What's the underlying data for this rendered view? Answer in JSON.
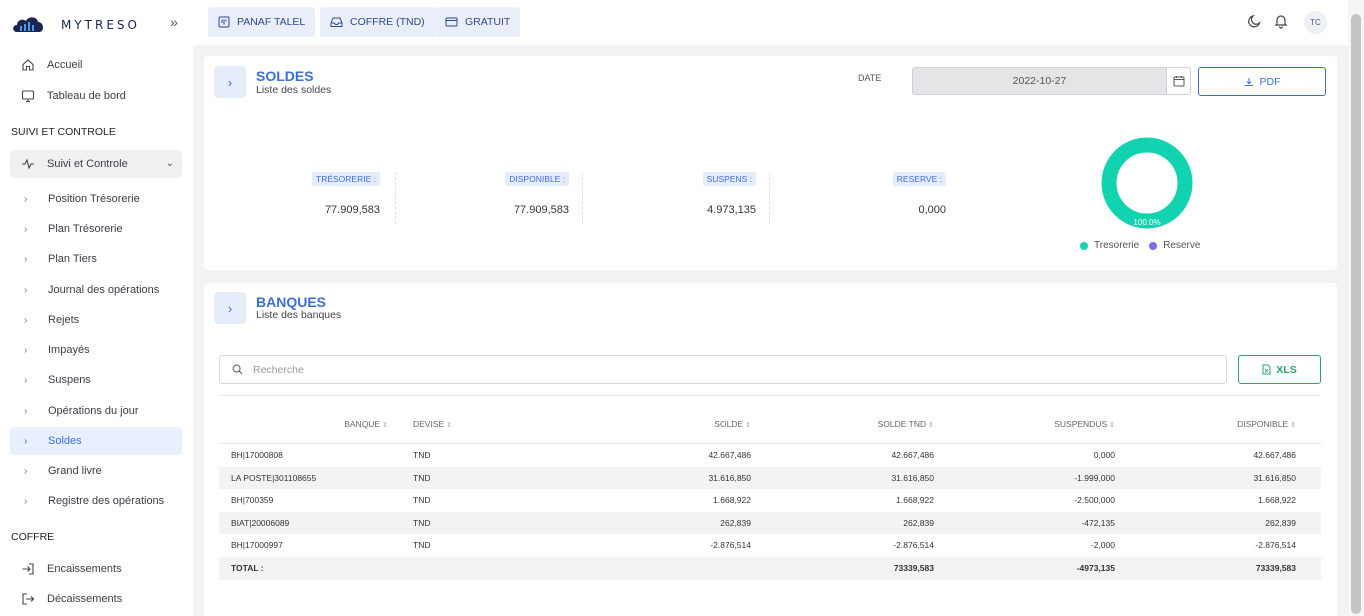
{
  "brand": {
    "name": "MYTRESO"
  },
  "sidebar": {
    "top_items": [
      {
        "label": "Accueil"
      },
      {
        "label": "Tableau de bord"
      }
    ],
    "section1": "SUIVI ET CONTROLE",
    "group_label": "Suivi et Controle",
    "sub_items": [
      {
        "label": "Position Trésorerie"
      },
      {
        "label": "Plan Trésorerie"
      },
      {
        "label": "Plan Tiers"
      },
      {
        "label": "Journal des opérations"
      },
      {
        "label": "Rejets"
      },
      {
        "label": "Impayés"
      },
      {
        "label": "Suspens"
      },
      {
        "label": "Opérations du jour"
      },
      {
        "label": "Soldes"
      },
      {
        "label": "Grand livre"
      },
      {
        "label": "Registre des opérations"
      }
    ],
    "active_item": "Soldes",
    "section2": "COFFRE",
    "coffre_items": [
      {
        "label": "Encaissements"
      },
      {
        "label": "Décaissements"
      }
    ]
  },
  "topbar": {
    "buttons": [
      {
        "label": "PANAF TALEL"
      },
      {
        "label": "COFFRE (TND)"
      },
      {
        "label": "GRATUIT"
      }
    ],
    "avatar": "TC"
  },
  "soldes": {
    "title": "SOLDES",
    "subtitle": "Liste des soldes",
    "date_label": "DATE",
    "date_value": "2022-10-27",
    "pdf_label": "PDF",
    "stats": [
      {
        "label": "TRÉSORERIE :",
        "value": "77.909,583"
      },
      {
        "label": "DISPONIBLE :",
        "value": "77.909,583"
      },
      {
        "label": "SUSPENS :",
        "value": "4.973,135"
      },
      {
        "label": "RESERVE :",
        "value": "0,000"
      }
    ]
  },
  "chart_data": {
    "type": "pie",
    "categories": [
      "Tresorerie",
      "Reserve"
    ],
    "values": [
      100,
      0
    ],
    "data_labels": [
      "100.0%"
    ],
    "colors": [
      "#12d3b0",
      "#7b6cf0"
    ],
    "legend": "bottom"
  },
  "banques": {
    "title": "BANQUES",
    "subtitle": "Liste des banques",
    "search_placeholder": "Recherche",
    "xls_label": "XLS",
    "columns": [
      "BANQUE",
      "DEVISE",
      "SOLDE",
      "SOLDE TND",
      "SUSPENDUS",
      "DISPONIBLE"
    ],
    "sort_glyph": "⇕",
    "rows": [
      [
        "BH|17000808",
        "TND",
        "42.667,486",
        "42.667,486",
        "0,000",
        "42.667,486"
      ],
      [
        "LA POSTE|301108655",
        "TND",
        "31.616,850",
        "31.616,850",
        "-1.999,000",
        "31.616,850"
      ],
      [
        "BH|700359",
        "TND",
        "1.668,922",
        "1.668,922",
        "-2.500,000",
        "1.668,922"
      ],
      [
        "BIAT|20006089",
        "TND",
        "262,839",
        "262,839",
        "-472,135",
        "262,839"
      ],
      [
        "BH|17000997",
        "TND",
        "-2.876,514",
        "-2.876,514",
        "-2,000",
        "-2.876,514"
      ]
    ],
    "total": {
      "label": "TOTAL :",
      "solde_tnd": "73339,583",
      "suspendus": "-4973,135",
      "disponible": "73339,583"
    }
  }
}
